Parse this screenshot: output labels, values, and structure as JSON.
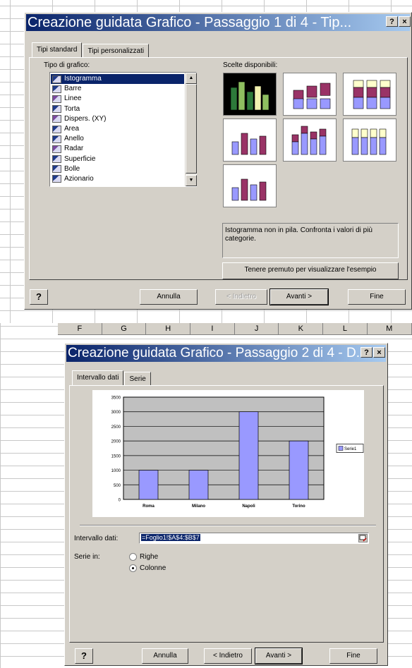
{
  "dialog1": {
    "title": "Creazione guidata Grafico - Passaggio 1 di 4 - Tip...",
    "title_help": "?",
    "title_close": "×",
    "tabs": [
      "Tipi standard",
      "Tipi personalizzati"
    ],
    "chart_type_label": "Tipo di grafico:",
    "chart_types": [
      {
        "label": "Istogramma",
        "icon": "column-chart-icon",
        "color": "#1f3a8a"
      },
      {
        "label": "Barre",
        "icon": "bar-chart-icon",
        "color": "#1f3a8a"
      },
      {
        "label": "Linee",
        "icon": "line-chart-icon",
        "color": "#7a4aa0"
      },
      {
        "label": "Torta",
        "icon": "pie-chart-icon",
        "color": "#1f3a8a"
      },
      {
        "label": "Dispers. (XY)",
        "icon": "scatter-chart-icon",
        "color": "#7a4aa0"
      },
      {
        "label": "Area",
        "icon": "area-chart-icon",
        "color": "#1f3a8a"
      },
      {
        "label": "Anello",
        "icon": "doughnut-chart-icon",
        "color": "#1f3a8a"
      },
      {
        "label": "Radar",
        "icon": "radar-chart-icon",
        "color": "#7a4aa0"
      },
      {
        "label": "Superficie",
        "icon": "surface-chart-icon",
        "color": "#1f3a8a"
      },
      {
        "label": "Bolle",
        "icon": "bubble-chart-icon",
        "color": "#1f3a8a"
      },
      {
        "label": "Azionario",
        "icon": "stock-chart-icon",
        "color": "#1f3a8a"
      }
    ],
    "subtype_label": "Scelte disponibili:",
    "subtypes": [
      "clustered-column-icon",
      "stacked-column-icon",
      "100-stacked-column-icon",
      "3d-clustered-column-icon",
      "3d-stacked-column-icon",
      "3d-100-stacked-column-icon",
      "3d-column-icon"
    ],
    "description": "Istogramma non in pila. Confronta i valori di più categorie.",
    "preview_button": "Tenere premuto per visualizzare l'esempio",
    "buttons": {
      "help": "?",
      "cancel": "Annulla",
      "back": "< Indietro",
      "next": "Avanti >",
      "finish": "Fine"
    }
  },
  "sheet": {
    "columns": [
      "F",
      "G",
      "H",
      "I",
      "J",
      "K",
      "L",
      "M"
    ]
  },
  "dialog2": {
    "title": "Creazione guidata Grafico - Passaggio 2 di 4 - D...",
    "title_help": "?",
    "title_close": "×",
    "tabs": [
      "Intervallo dati",
      "Serie"
    ],
    "range_label": "Intervallo dati:",
    "range_value": "=Foglio1!$A$4:$B$7",
    "series_in_label": "Serie in:",
    "series_options": [
      {
        "label": "Righe",
        "selected": false
      },
      {
        "label": "Colonne",
        "selected": true
      }
    ],
    "buttons": {
      "help": "?",
      "cancel": "Annulla",
      "back": "< Indietro",
      "next": "Avanti >",
      "finish": "Fine"
    },
    "chart_data": {
      "type": "bar",
      "categories": [
        "Roma",
        "Milano",
        "Napoli",
        "Torino"
      ],
      "series": [
        {
          "name": "Serie1",
          "values": [
            1000,
            1000,
            3000,
            2000
          ]
        }
      ],
      "ylim": [
        0,
        3500
      ],
      "yticks": [
        0,
        500,
        1000,
        1500,
        2000,
        2500,
        3000,
        3500
      ],
      "bar_color": "#9999ff",
      "plot_bg": "#c0c0c0",
      "legend_position": "right"
    }
  }
}
